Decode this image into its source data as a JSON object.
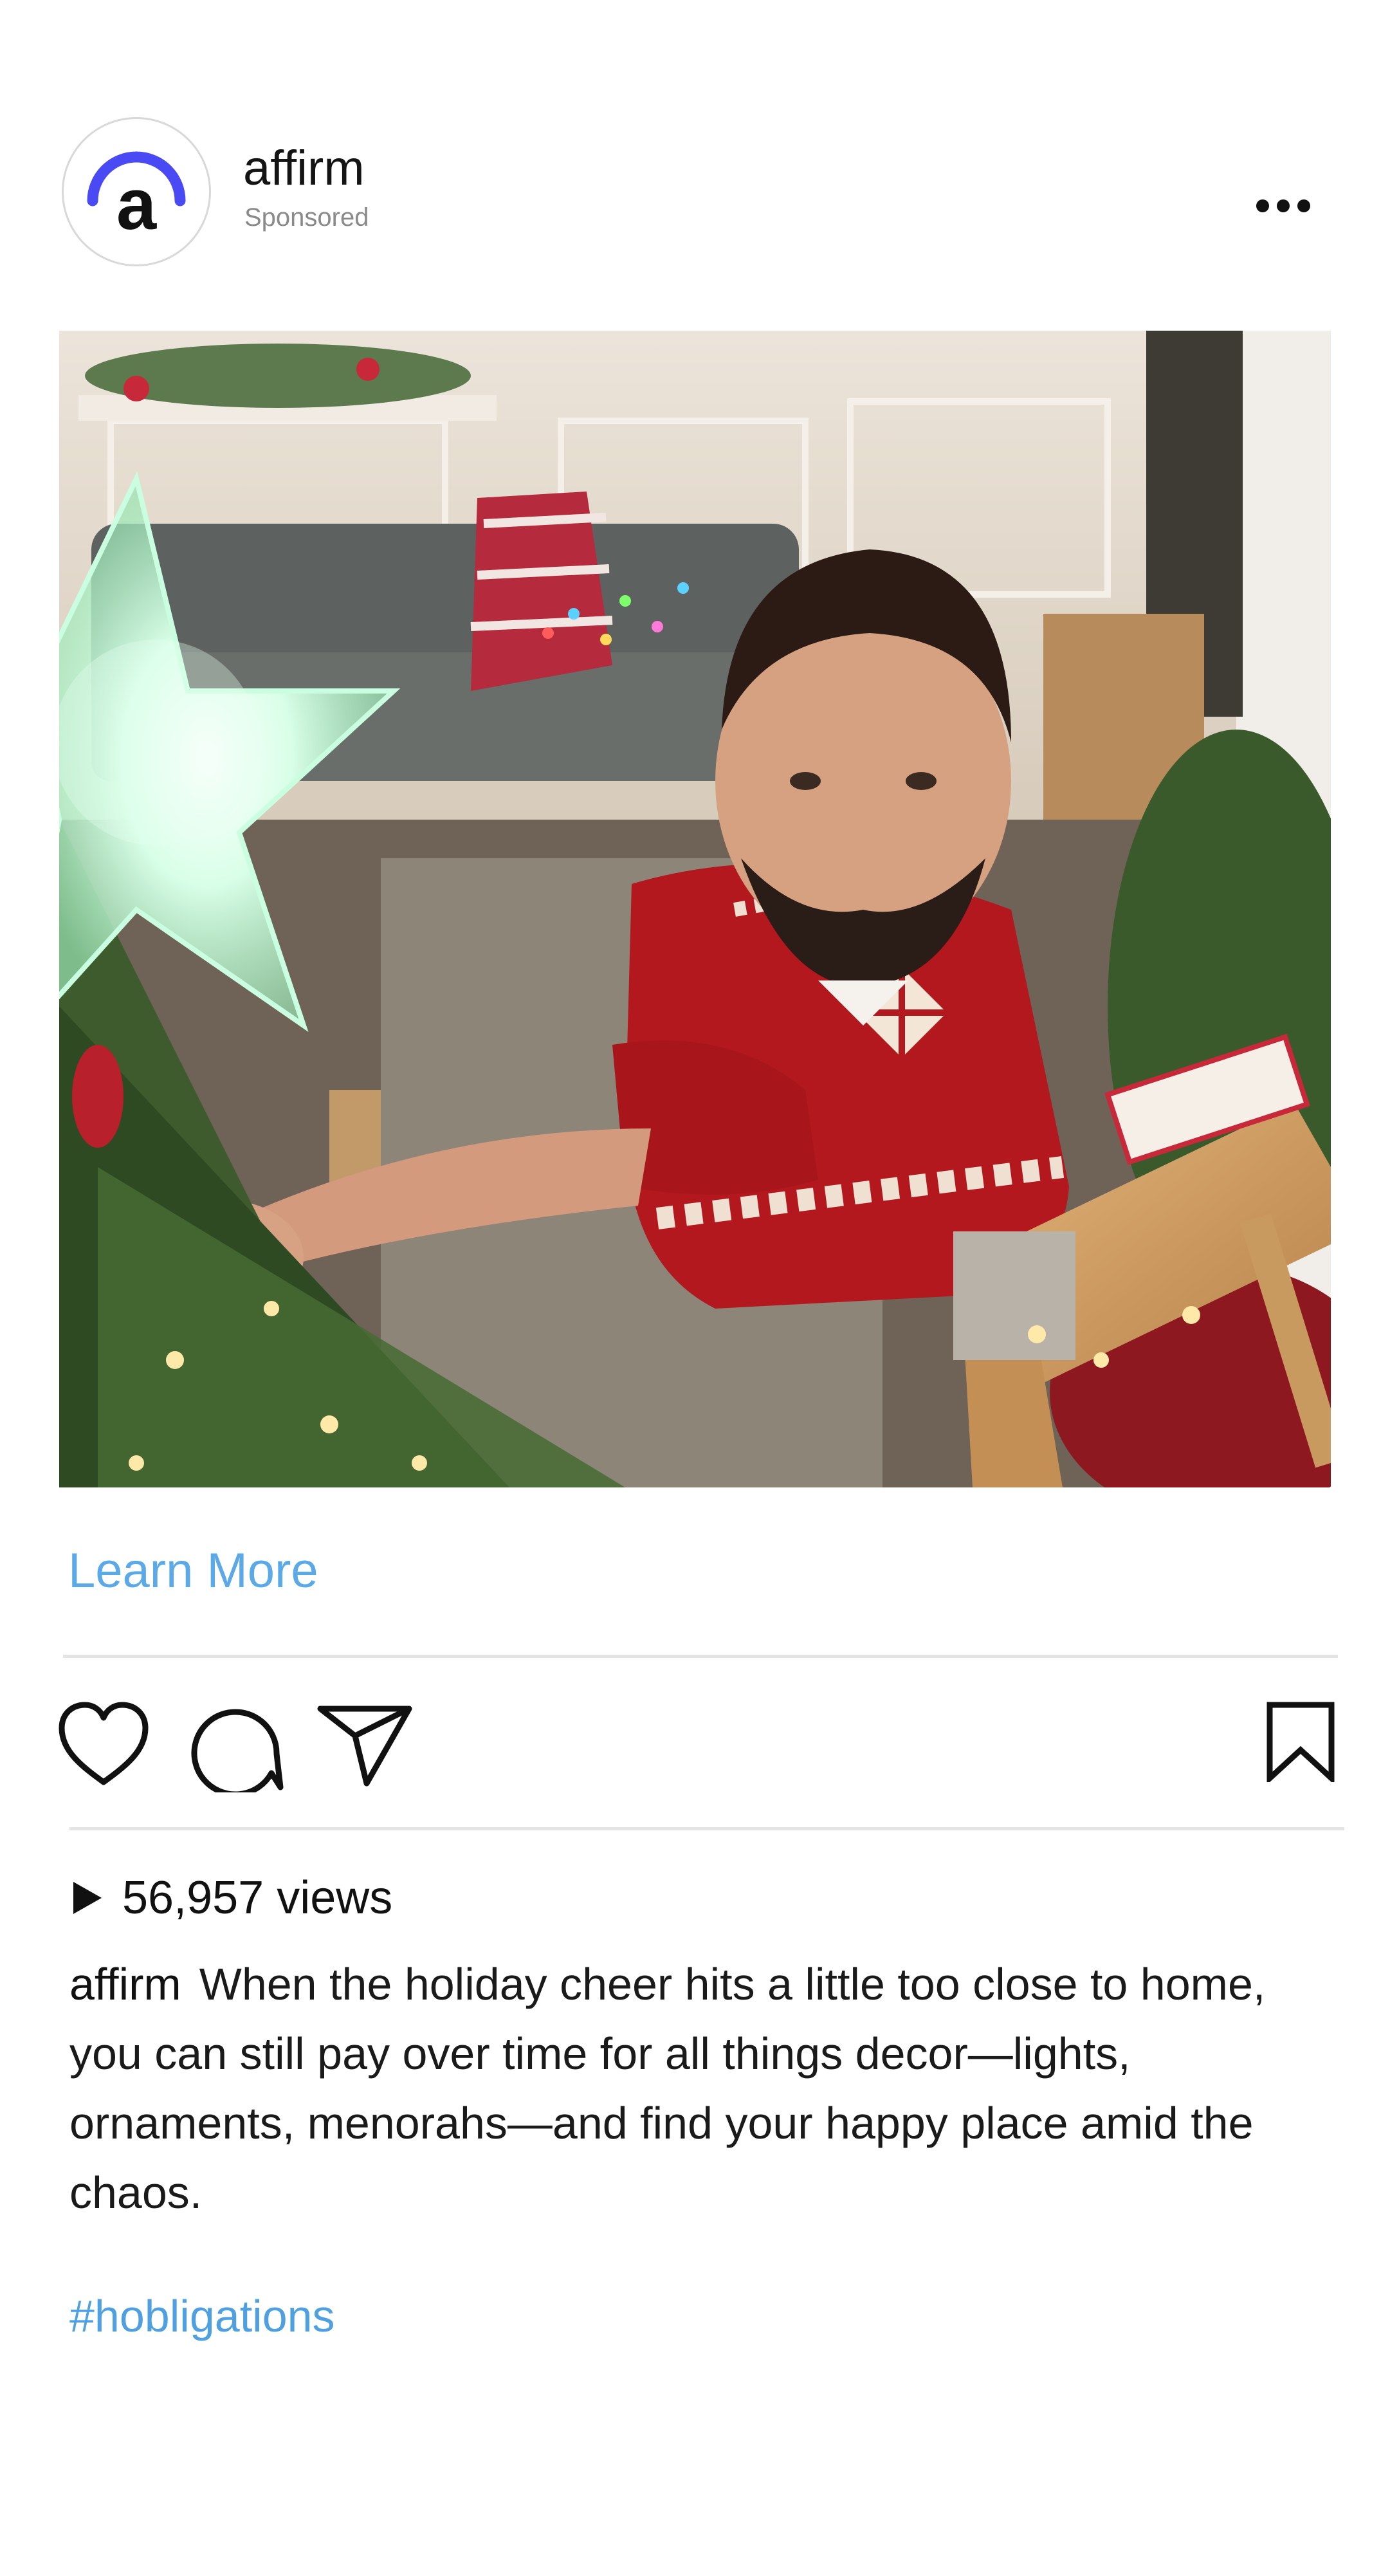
{
  "post": {
    "account_name": "affirm",
    "sponsored_label": "Sponsored",
    "avatar_letter": "a",
    "brand_color": "#4a4af4"
  },
  "media": {
    "image_subject": "man placing a lit star on a Christmas tree from a wooden step ladder"
  },
  "cta": {
    "label": "Learn More",
    "color": "#5ba9e6"
  },
  "actions": {
    "icons": [
      "heart-icon",
      "comment-icon",
      "share-icon",
      "bookmark-icon"
    ]
  },
  "stats": {
    "views_label": "56,957 views"
  },
  "caption": {
    "username": "affirm",
    "text": "When the holiday cheer hits a little too close to home, you can still pay over time for all things decor—lights, ornaments, menorahs—and find your happy place amid the chaos.",
    "hashtag": "#hobligations",
    "hashtag_color": "#4fa0e0"
  }
}
